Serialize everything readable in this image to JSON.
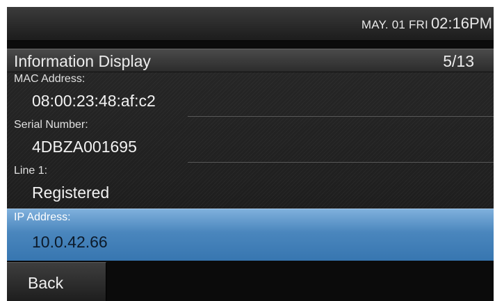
{
  "status_bar": {
    "date": "MAY. 01 FRI",
    "time": "02:16PM"
  },
  "panel": {
    "title": "Information Display",
    "page_indicator": "5/13",
    "items": [
      {
        "label": "MAC Address:",
        "value": "08:00:23:48:af:c2",
        "selected": false
      },
      {
        "label": "Serial Number:",
        "value": "4DBZA001695",
        "selected": false
      },
      {
        "label": "Line 1:",
        "value": "Registered",
        "selected": false
      },
      {
        "label": "IP Address:",
        "value": "10.0.42.66",
        "selected": true
      }
    ]
  },
  "softkeys": {
    "back_label": "Back"
  },
  "colors": {
    "selected_highlight": "#4a86bd",
    "background": "#0c0c0c"
  }
}
